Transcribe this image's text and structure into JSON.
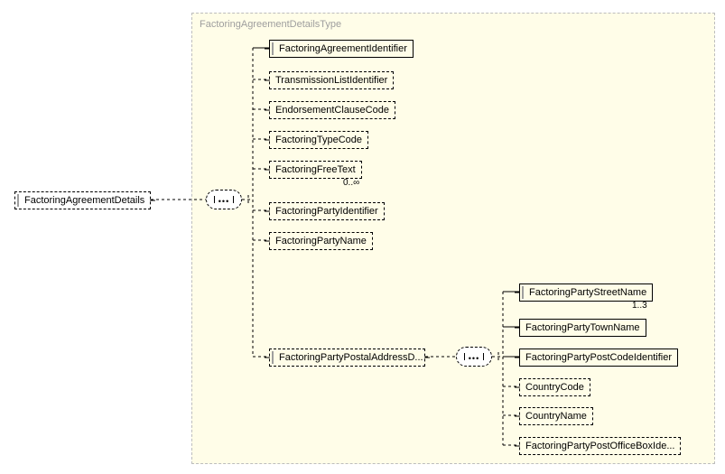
{
  "type_name": "FactoringAgreementDetailsType",
  "root": {
    "label": "FactoringAgreementDetails"
  },
  "level1": {
    "n1": {
      "label": "FactoringAgreementIdentifier"
    },
    "n2": {
      "label": "TransmissionListIdentifier"
    },
    "n3": {
      "label": "EndorsementClauseCode"
    },
    "n4": {
      "label": "FactoringTypeCode"
    },
    "n5": {
      "label": "FactoringFreeText",
      "multiplicity": "0..∞"
    },
    "n6": {
      "label": "FactoringPartyIdentifier"
    },
    "n7": {
      "label": "FactoringPartyName"
    },
    "n8": {
      "label": "FactoringPartyPostalAddressD..."
    }
  },
  "level2": {
    "m1": {
      "label": "FactoringPartyStreetName",
      "multiplicity": "1..3"
    },
    "m2": {
      "label": "FactoringPartyTownName"
    },
    "m3": {
      "label": "FactoringPartyPostCodeIdentifier"
    },
    "m4": {
      "label": "CountryCode"
    },
    "m5": {
      "label": "CountryName"
    },
    "m6": {
      "label": "FactoringPartyPostOfficeBoxIde..."
    }
  }
}
